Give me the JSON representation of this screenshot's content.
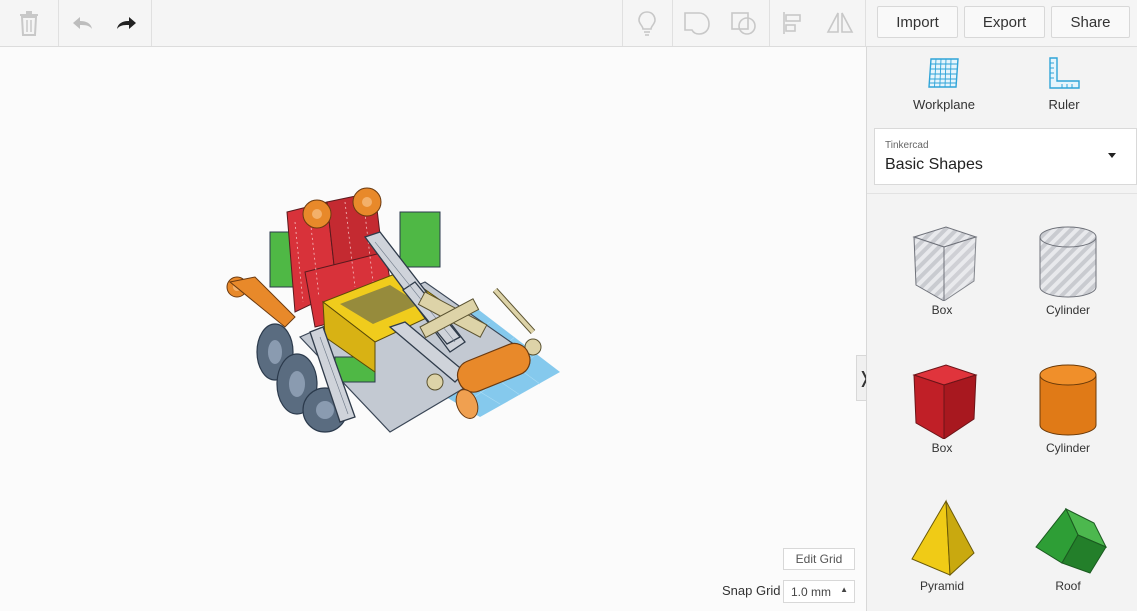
{
  "toolbar": {
    "icons": [
      "trash-icon",
      "undo-icon",
      "redo-icon",
      "lightbulb-icon",
      "group-icon",
      "ungroup-icon",
      "align-icon",
      "mirror-icon"
    ],
    "import_label": "Import",
    "export_label": "Export",
    "share_label": "Share"
  },
  "canvas": {
    "edit_grid_label": "Edit Grid",
    "snap_grid_label": "Snap Grid",
    "snap_grid_value": "1.0 mm",
    "collapse_glyph": "❭"
  },
  "sidebar": {
    "tools": [
      {
        "label": "Workplane",
        "icon": "workplane-icon"
      },
      {
        "label": "Ruler",
        "icon": "ruler-icon"
      }
    ],
    "library": {
      "subtitle": "Tinkercad",
      "title": "Basic Shapes"
    },
    "shapes": [
      {
        "label": "Box",
        "icon": "box-hole-icon"
      },
      {
        "label": "Cylinder",
        "icon": "cylinder-hole-icon"
      },
      {
        "label": "Box",
        "icon": "box-icon"
      },
      {
        "label": "Cylinder",
        "icon": "cylinder-icon"
      },
      {
        "label": "Pyramid",
        "icon": "pyramid-icon"
      },
      {
        "label": "Roof",
        "icon": "roof-icon"
      }
    ]
  },
  "colors": {
    "accent_blue": "#2fa4d8",
    "box_red": "#cc1f26",
    "cylinder_orange": "#e07a17",
    "pyramid_yellow": "#f0cb16",
    "roof_green": "#2e9e36"
  }
}
